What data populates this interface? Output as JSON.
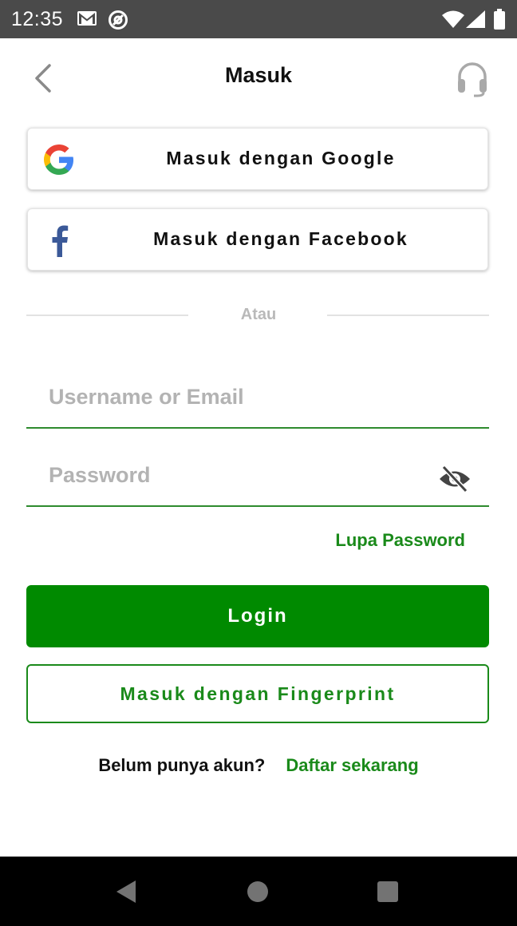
{
  "status_bar": {
    "time": "12:35",
    "icons": [
      "gmail-icon",
      "at-sign-icon",
      "wifi-icon",
      "signal-icon",
      "battery-icon"
    ]
  },
  "header": {
    "title": "Masuk",
    "back_icon": "chevron-left-icon",
    "support_icon": "headset-icon"
  },
  "social_login": {
    "google_label": "Masuk dengan Google",
    "facebook_label": "Masuk dengan Facebook"
  },
  "divider": {
    "text": "Atau"
  },
  "form": {
    "username_placeholder": "Username or Email",
    "username_value": "",
    "password_placeholder": "Password",
    "password_value": "",
    "visibility_icon": "eye-off-icon",
    "forgot_label": "Lupa Password"
  },
  "actions": {
    "login_label": "Login",
    "fingerprint_label": "Masuk dengan Fingerprint"
  },
  "signup": {
    "question": "Belum punya akun?",
    "link_label": "Daftar sekarang"
  },
  "nav_bar": {
    "icons": [
      "back-triangle-icon",
      "home-circle-icon",
      "recents-square-icon"
    ]
  },
  "colors": {
    "primary_green": "#008a00",
    "link_green": "#1a8a1a",
    "status_bar": "#4a4a4a",
    "facebook_blue": "#3b5998"
  }
}
